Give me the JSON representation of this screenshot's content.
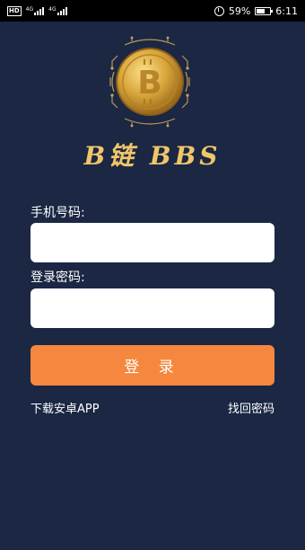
{
  "status_bar": {
    "hd_badge": "HD",
    "net_tag_1": "4G",
    "net_tag_2": "4G",
    "battery_percent": "59%",
    "battery_level": 0.59,
    "time": "6:11"
  },
  "logo": {
    "title": "B链 BBS",
    "colors": {
      "coin": "#d9a63a",
      "coin_light": "#f6d77c",
      "ring": "#c9a35a"
    }
  },
  "form": {
    "phone_label": "手机号码:",
    "phone_value": "",
    "password_label": "登录密码:",
    "password_value": "",
    "login_button": "登 录"
  },
  "links": {
    "download": "下载安卓APP",
    "forgot": "找回密码"
  },
  "colors": {
    "background": "#1b2743",
    "accent": "#f5873f"
  }
}
